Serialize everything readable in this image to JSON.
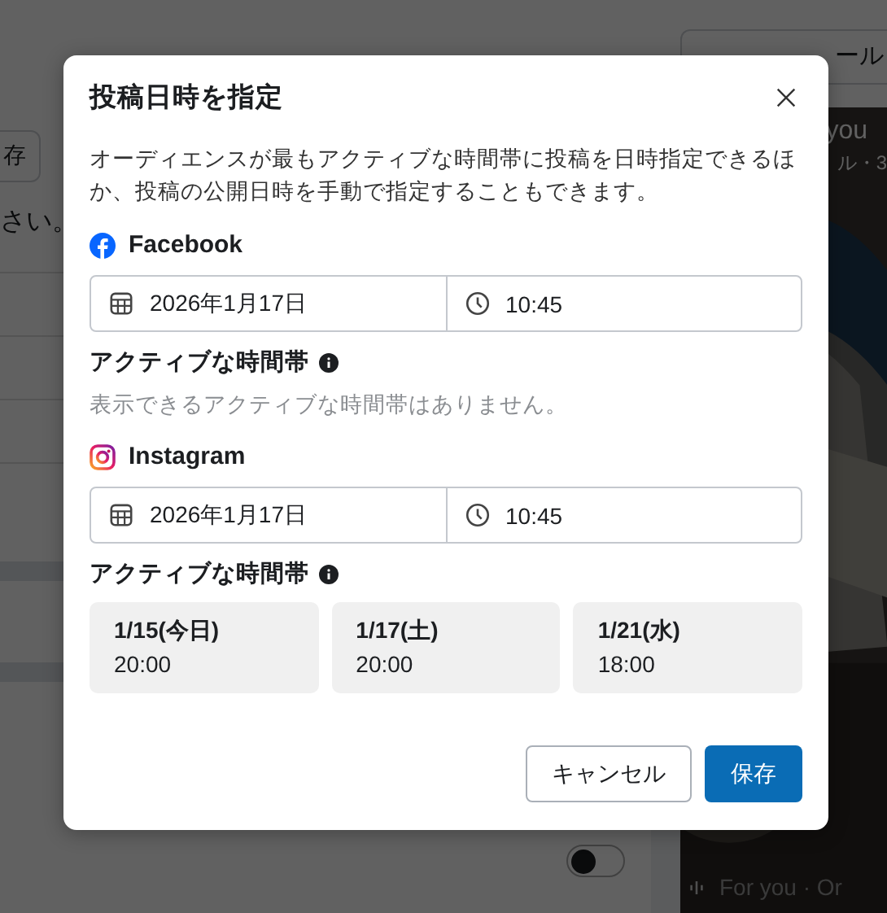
{
  "background": {
    "top_button": "ール",
    "save_button": "存",
    "note": "さい。",
    "preview": {
      "title": "you",
      "meta": "ル・3",
      "caption": "For you · Or"
    },
    "toggle": {
      "on": false
    }
  },
  "dialog": {
    "title": "投稿日時を指定",
    "description": "オーディエンスが最もアクティブな時間帯に投稿を日時指定できるほか、投稿の公開日時を手動で指定することもできます。",
    "platforms": [
      {
        "kind": "facebook",
        "name": "Facebook",
        "date": "2026年1月17日",
        "time": "10:45",
        "active_heading": "アクティブな時間帯",
        "empty_message": "表示できるアクティブな時間帯はありません。"
      },
      {
        "kind": "instagram",
        "name": "Instagram",
        "date": "2026年1月17日",
        "time": "10:45",
        "active_heading": "アクティブな時間帯",
        "slots": [
          {
            "date": "1/15(今日)",
            "time": "20:00"
          },
          {
            "date": "1/17(土)",
            "time": "20:00"
          },
          {
            "date": "1/21(水)",
            "time": "18:00"
          }
        ]
      }
    ],
    "buttons": [
      {
        "kind": "secondary",
        "label": "キャンセル"
      },
      {
        "kind": "primary",
        "label": "保存"
      }
    ]
  }
}
